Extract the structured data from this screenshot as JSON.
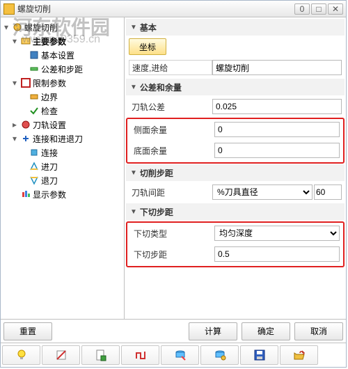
{
  "watermark": {
    "text": "河东软件园",
    "url": "www.pc0359.cn"
  },
  "title": "螺旋切削",
  "winbuttons": {
    "min": "0",
    "max": "□",
    "close": "✕"
  },
  "tree": {
    "root": "螺旋切削",
    "n0": "主要参数",
    "n0_0": "基本设置",
    "n0_1": "公差和步距",
    "n1": "限制参数",
    "n1_0": "边界",
    "n1_1": "检查",
    "n2": "刀轨设置",
    "n3": "连接和进退刀",
    "n3_0": "连接",
    "n3_1": "进刀",
    "n3_2": "退刀",
    "n4": "显示参数"
  },
  "sections": {
    "basic": "基本",
    "tolerance": "公差和余量",
    "cutstep": "切削步距",
    "downstep": "下切步距"
  },
  "basic": {
    "coord_btn": "坐标",
    "speed_label": "速度,进给",
    "speed_value": "螺旋切削"
  },
  "tol": {
    "tolerance_label": "刀轨公差",
    "tolerance_value": "0.025",
    "side_label": "侧面余量",
    "side_value": "0",
    "bottom_label": "底面余量",
    "bottom_value": "0"
  },
  "cut": {
    "spacing_label": "刀轨间距",
    "spacing_mode": "%刀具直径",
    "spacing_value": "60"
  },
  "down": {
    "type_label": "下切类型",
    "type_value": "均匀深度",
    "step_label": "下切步距",
    "step_value": "0.5"
  },
  "footer": {
    "reset": "重置",
    "calc": "计算",
    "ok": "确定",
    "cancel": "取消"
  }
}
